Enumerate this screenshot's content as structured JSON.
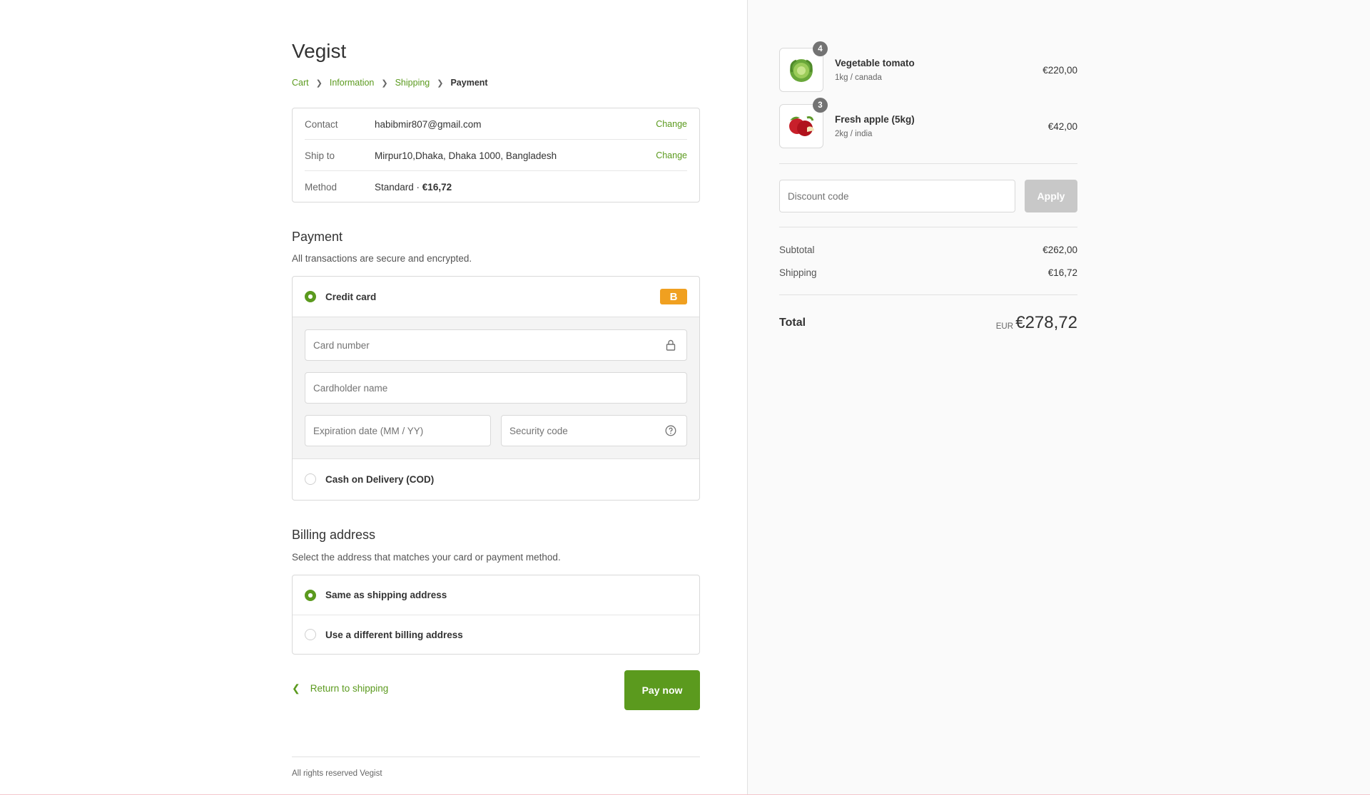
{
  "brand": {
    "name": "Vegist",
    "accent": "#5b9a1e"
  },
  "breadcrumb": [
    {
      "label": "Cart"
    },
    {
      "label": "Information"
    },
    {
      "label": "Shipping"
    },
    {
      "label": "Payment"
    }
  ],
  "review": {
    "contact": {
      "label": "Contact",
      "value": "habibmir807@gmail.com",
      "change": "Change"
    },
    "shipto": {
      "label": "Ship to",
      "value": "Mirpur10,Dhaka, Dhaka 1000, Bangladesh",
      "change": "Change"
    },
    "method": {
      "label": "Method",
      "value": "Standard · ",
      "price": "€16,72"
    }
  },
  "payment": {
    "title": "Payment",
    "subtitle": "All transactions are secure and encrypted.",
    "credit_card_label": "Credit card",
    "card_brand_badge": "B",
    "card_number_placeholder": "Card number",
    "cardholder_placeholder": "Cardholder name",
    "expiration_placeholder": "Expiration date (MM / YY)",
    "security_placeholder": "Security code",
    "cod_label": "Cash on Delivery (COD)",
    "selected": "credit-card"
  },
  "billing": {
    "title": "Billing address",
    "subtitle": "Select the address that matches your card or payment method.",
    "same_label": "Same as shipping address",
    "different_label": "Use a different billing address",
    "selected": "same"
  },
  "actions": {
    "return_label": "Return to shipping",
    "pay_label": "Pay now"
  },
  "footer": {
    "text": "All rights reserved Vegist"
  },
  "summary": {
    "items": [
      {
        "qty": "4",
        "name": "Vegetable tomato",
        "variant": "1kg / canada",
        "price": "€220,00",
        "image": "cabbage-image"
      },
      {
        "qty": "3",
        "name": "Fresh apple (5kg)",
        "variant": "2kg / india",
        "price": "€42,00",
        "image": "apple-image"
      }
    ],
    "discount_placeholder": "Discount code",
    "apply_label": "Apply",
    "subtotal_label": "Subtotal",
    "subtotal_value": "€262,00",
    "shipping_label": "Shipping",
    "shipping_value": "€16,72",
    "total_label": "Total",
    "currency": "EUR",
    "total_value": "€278,72"
  }
}
